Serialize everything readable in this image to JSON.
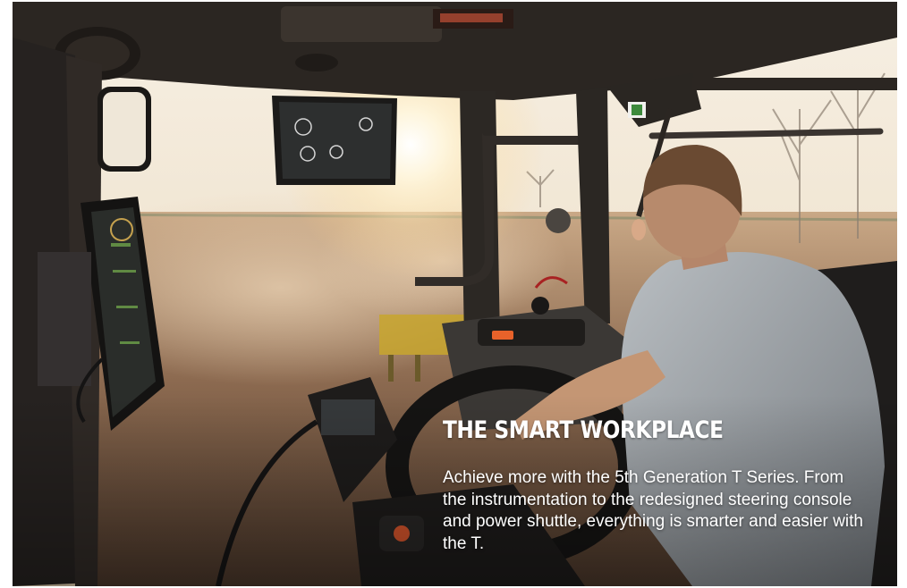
{
  "hero": {
    "headline": "THE SMART WORKPLACE",
    "body": "Achieve more with the 5th Generation T Series. From the instrumentation to the redesigned steering console and power shuttle, everything is smarter and easier with the T.",
    "photo_subject": "tractor-cab-interior-operator",
    "accent_color": "#e8622a"
  }
}
